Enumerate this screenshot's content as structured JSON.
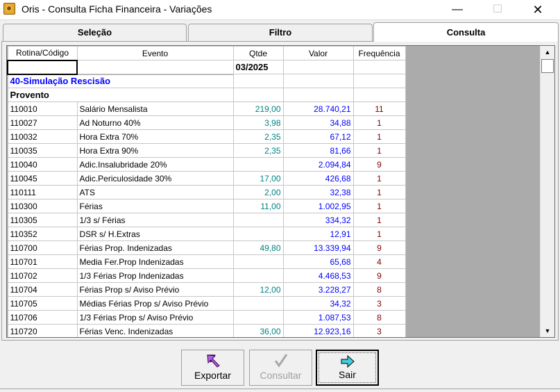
{
  "window": {
    "title": "Oris - Consulta Ficha Financeira - Variações",
    "minimize": "—",
    "maximize": "☐",
    "close": "✕"
  },
  "tabs": [
    {
      "label": "Seleção"
    },
    {
      "label": "Filtro"
    },
    {
      "label": "Consulta"
    }
  ],
  "grid": {
    "columns": [
      "Rotina/Código",
      "Evento",
      "Qtde",
      "Valor",
      "Frequência"
    ],
    "period": "03/2025",
    "group": "40-Simulação Rescisão",
    "section": "Provento",
    "rows": [
      {
        "codigo": "110010",
        "evento": "Salário Mensalista",
        "qtde": "219,00",
        "valor": "28.740,21",
        "freq": "11"
      },
      {
        "codigo": "110027",
        "evento": "Ad Noturno 40%",
        "qtde": "3,98",
        "valor": "34,88",
        "freq": "1"
      },
      {
        "codigo": "110032",
        "evento": "Hora Extra 70%",
        "qtde": "2,35",
        "valor": "67,12",
        "freq": "1"
      },
      {
        "codigo": "110035",
        "evento": "Hora Extra 90%",
        "qtde": "2,35",
        "valor": "81,66",
        "freq": "1"
      },
      {
        "codigo": "110040",
        "evento": "Adic.Insalubridade 20%",
        "qtde": "",
        "valor": "2.094,84",
        "freq": "9"
      },
      {
        "codigo": "110045",
        "evento": "Adic.Periculosidade 30%",
        "qtde": "17,00",
        "valor": "426,68",
        "freq": "1"
      },
      {
        "codigo": "110111",
        "evento": "ATS",
        "qtde": "2,00",
        "valor": "32,38",
        "freq": "1"
      },
      {
        "codigo": "110300",
        "evento": "Férias",
        "qtde": "11,00",
        "valor": "1.002,95",
        "freq": "1"
      },
      {
        "codigo": "110305",
        "evento": "1/3 s/ Férias",
        "qtde": "",
        "valor": "334,32",
        "freq": "1"
      },
      {
        "codigo": "110352",
        "evento": "DSR s/ H.Extras",
        "qtde": "",
        "valor": "12,91",
        "freq": "1"
      },
      {
        "codigo": "110700",
        "evento": "Férias Prop. Indenizadas",
        "qtde": "49,80",
        "valor": "13.339,94",
        "freq": "9"
      },
      {
        "codigo": "110701",
        "evento": "Media Fer.Prop Indenizadas",
        "qtde": "",
        "valor": "65,68",
        "freq": "4"
      },
      {
        "codigo": "110702",
        "evento": "1/3 Férias Prop Indenizadas",
        "qtde": "",
        "valor": "4.468,53",
        "freq": "9"
      },
      {
        "codigo": "110704",
        "evento": "Férias Prop s/ Aviso Prévio",
        "qtde": "12,00",
        "valor": "3.228,27",
        "freq": "8"
      },
      {
        "codigo": "110705",
        "evento": "Médias Férias Prop s/ Aviso Prévio",
        "qtde": "",
        "valor": "34,32",
        "freq": "3"
      },
      {
        "codigo": "110706",
        "evento": "1/3 Férias Prop s/ Aviso Prévio",
        "qtde": "",
        "valor": "1.087,53",
        "freq": "8"
      },
      {
        "codigo": "110720",
        "evento": "Férias Venc. Indenizadas",
        "qtde": "36,00",
        "valor": "12.923,16",
        "freq": "3"
      }
    ]
  },
  "buttons": {
    "exportar": "Exportar",
    "consultar": "Consultar",
    "sair": "Sair"
  },
  "colors": {
    "group_text": "#0000ff",
    "qtde_text": "#008080",
    "valor_text": "#0000ff",
    "freq_text": "#800000"
  }
}
